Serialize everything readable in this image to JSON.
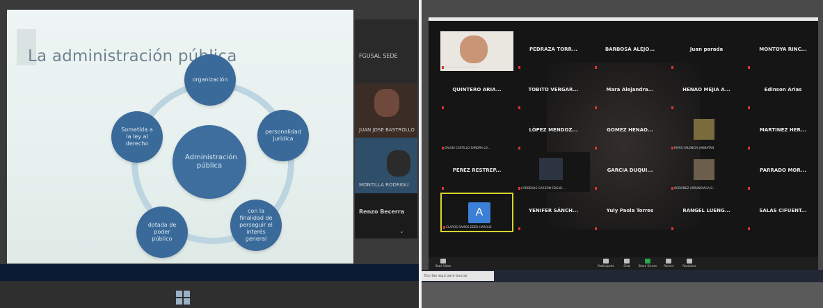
{
  "left": {
    "slide": {
      "title": "La administración pública",
      "center": "Administración pública",
      "nodes": [
        "organización",
        "personalidad jurídica",
        "con la finalidad de perseguir el interés general",
        "dotada de poder público",
        "Sometida a la ley al derecho"
      ]
    },
    "participants": [
      {
        "name": "FGUSAL SEDE"
      },
      {
        "name": "JUAN JOSE BASTROLLO"
      },
      {
        "name": "MONTILLA RODRIGU"
      },
      {
        "name": "Renzo Becerra"
      }
    ]
  },
  "right": {
    "tiles": [
      {
        "name": "",
        "label": "Antonio García Jiménez",
        "type": "video"
      },
      {
        "name": "PEDRAZA TORR...",
        "label": "",
        "type": "name"
      },
      {
        "name": "BARBOSA ALEJO...",
        "label": "",
        "type": "name"
      },
      {
        "name": "Juan parada",
        "label": "",
        "type": "name"
      },
      {
        "name": "MONTOYA RINC...",
        "label": "",
        "type": "name"
      },
      {
        "name": "QUINTERO ARIA...",
        "label": "",
        "type": "name"
      },
      {
        "name": "TOBITO VERGAR...",
        "label": "",
        "type": "name"
      },
      {
        "name": "Mara Alejandra...",
        "label": "",
        "type": "name"
      },
      {
        "name": "HENAO MEJIA A...",
        "label": "",
        "type": "name"
      },
      {
        "name": "Edinson Arias",
        "label": "",
        "type": "name"
      },
      {
        "name": "",
        "label": "GALVIS CASTILLO SANDRA LO...",
        "type": "blank"
      },
      {
        "name": "LÓPEZ MENDOZ...",
        "label": "",
        "type": "name"
      },
      {
        "name": "GOMEZ HENAO...",
        "label": "",
        "type": "name"
      },
      {
        "name": "",
        "label": "RIVAS VALENCIA JHONATAN",
        "type": "img"
      },
      {
        "name": "MARTINEZ HER...",
        "label": "",
        "type": "name"
      },
      {
        "name": "PEREZ RESTREP...",
        "label": "",
        "type": "name"
      },
      {
        "name": "",
        "label": "CÁRDENAS GARZÓN EDGAR...",
        "type": "video"
      },
      {
        "name": "GARCIA DUQUI...",
        "label": "",
        "type": "name"
      },
      {
        "name": "",
        "label": "ORDOÑEZ ARRUNDIAGA B...",
        "type": "img"
      },
      {
        "name": "PARRADO MOR...",
        "label": "",
        "type": "name"
      },
      {
        "name": "A",
        "label": "CLAROS RAMOS EDER HAROLD",
        "type": "avatar"
      },
      {
        "name": "YENIFER SÁNCH...",
        "label": "",
        "type": "name"
      },
      {
        "name": "Yuly Paola Torres",
        "label": "",
        "type": "name"
      },
      {
        "name": "RANGEL LUENG...",
        "label": "",
        "type": "name"
      },
      {
        "name": "SALAS CIFUENT...",
        "label": "",
        "type": "name"
      }
    ],
    "toolbar": [
      {
        "label": "Start Video",
        "icon": "video-icon"
      },
      {
        "label": "Participants",
        "icon": "participants-icon"
      },
      {
        "label": "Chat",
        "icon": "chat-icon"
      },
      {
        "label": "Share Screen",
        "icon": "share-icon"
      },
      {
        "label": "Record",
        "icon": "record-icon"
      },
      {
        "label": "Reactions",
        "icon": "reactions-icon"
      }
    ],
    "search_placeholder": "Escribe aquí para buscar"
  }
}
